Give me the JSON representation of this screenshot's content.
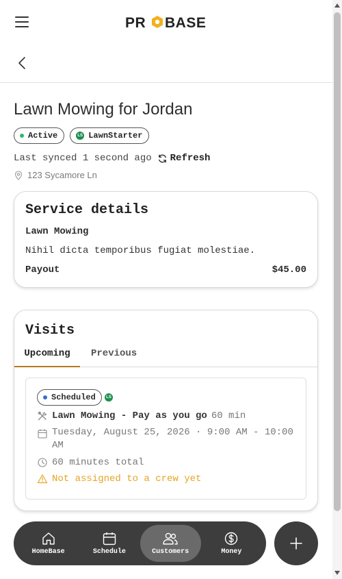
{
  "header": {
    "logo_text": "PROBASE"
  },
  "job": {
    "title": "Lawn Mowing for Jordan",
    "status_badge": "Active",
    "source_badge": "LawnStarter",
    "source_logo_text": "LS",
    "sync_text": "Last synced 1 second ago",
    "refresh_label": "Refresh",
    "address": "123 Sycamore Ln"
  },
  "service": {
    "heading": "Service details",
    "name": "Lawn Mowing",
    "description": "Nihil dicta temporibus fugiat molestiae.",
    "payout_label": "Payout",
    "payout_value": "$45.00"
  },
  "visits": {
    "heading": "Visits",
    "tabs": [
      {
        "label": "Upcoming",
        "active": true
      },
      {
        "label": "Previous",
        "active": false
      }
    ],
    "items": [
      {
        "status": "Scheduled",
        "service": "Lawn Mowing - Pay as you go",
        "duration": "60 min",
        "datetime": "Tuesday, August 25, 2026 · 9:00 AM - 10:00 AM",
        "total": "60 minutes total",
        "warning": "Not assigned to a crew yet"
      }
    ]
  },
  "nav": {
    "items": [
      {
        "label": "HomeBase",
        "icon": "home-icon",
        "active": false
      },
      {
        "label": "Schedule",
        "icon": "calendar-icon",
        "active": false
      },
      {
        "label": "Customers",
        "icon": "users-icon",
        "active": true
      },
      {
        "label": "Money",
        "icon": "dollar-icon",
        "active": false
      }
    ],
    "fab_icon": "plus-icon"
  },
  "colors": {
    "active_dot": "#2eb86b",
    "scheduled_dot": "#2f6fd6",
    "source_green": "#1e8e4e",
    "tab_underline": "#b07a1e",
    "warning": "#e6a422",
    "nav_bg": "#3d3d3d",
    "nav_active": "#6a6a6a"
  }
}
